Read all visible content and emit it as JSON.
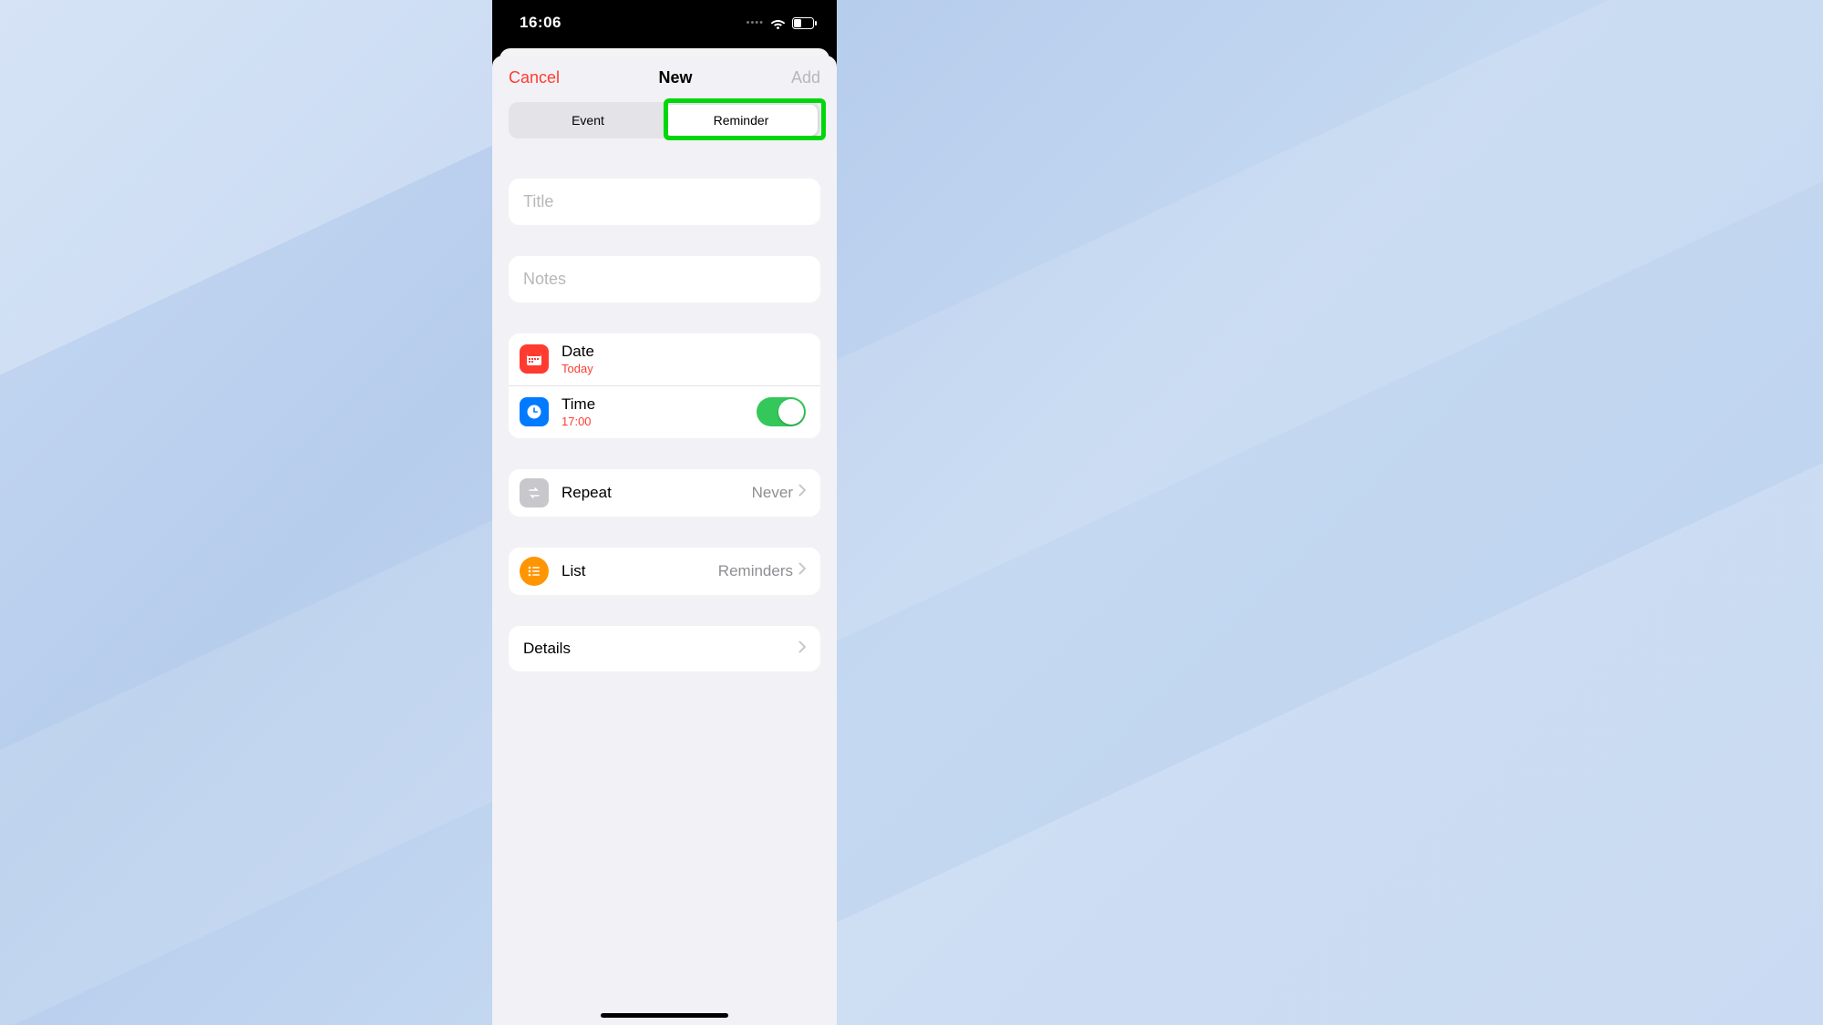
{
  "statusbar": {
    "time": "16:06"
  },
  "nav": {
    "cancel": "Cancel",
    "title": "New",
    "add": "Add"
  },
  "segmented": {
    "event": "Event",
    "reminder": "Reminder"
  },
  "fields": {
    "title_placeholder": "Title",
    "notes_placeholder": "Notes"
  },
  "date": {
    "label": "Date",
    "value": "Today"
  },
  "time": {
    "label": "Time",
    "value": "17:00",
    "enabled": true
  },
  "repeat": {
    "label": "Repeat",
    "value": "Never"
  },
  "list": {
    "label": "List",
    "value": "Reminders"
  },
  "details": {
    "label": "Details"
  },
  "colors": {
    "accent_red": "#ff3b30",
    "accent_blue": "#007aff",
    "accent_green": "#34c759",
    "accent_orange": "#ff9500",
    "highlight_green": "#00d70b"
  }
}
